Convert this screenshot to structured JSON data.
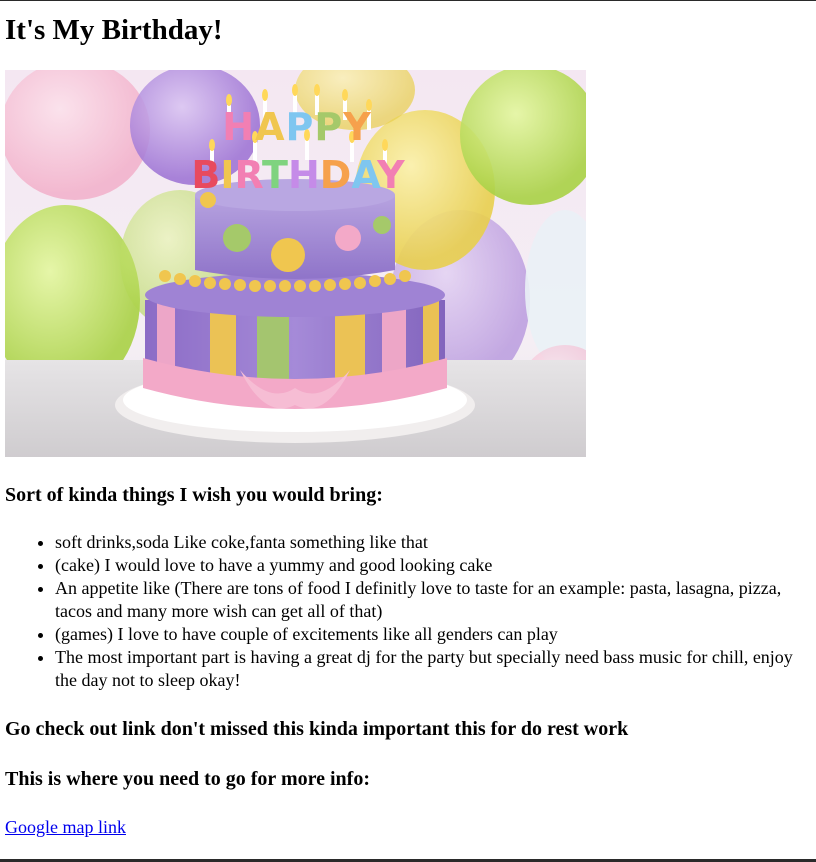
{
  "page": {
    "title": "It's My Birthday!",
    "hero_image": {
      "name": "birthday-cake-image",
      "candle_text_top": "HAPPY",
      "candle_text_bottom": "BIRTHDAY"
    },
    "bring_heading": "Sort of kinda things I wish you would bring:",
    "wish_items": [
      "soft drinks,soda Like coke,fanta something like that",
      "(cake) I would love to have a yummy and good looking cake",
      "An appetite like (There are tons of food I definitly love to taste for an example: pasta, lasagna, pizza, tacos and many more wish can get all of that)",
      "(games) I love to have couple of excitements like all genders can play",
      "The most important part is having a great dj for the party but specially need bass music for chill, enjoy the day not to sleep okay!"
    ],
    "check_heading": "Go check out link don't missed this kinda important this for do rest work",
    "info_heading": "This is where you need to go for more info:",
    "map_link_text": "Google map link"
  },
  "colors": {
    "link": "#0000ee",
    "cake_purple": "#9b82cf",
    "cake_pink": "#f3a9c8",
    "cake_yellow": "#f0c64f",
    "cake_green": "#a5c96a",
    "balloon_green": "#c7e86a",
    "balloon_purple": "#b58ee0"
  }
}
